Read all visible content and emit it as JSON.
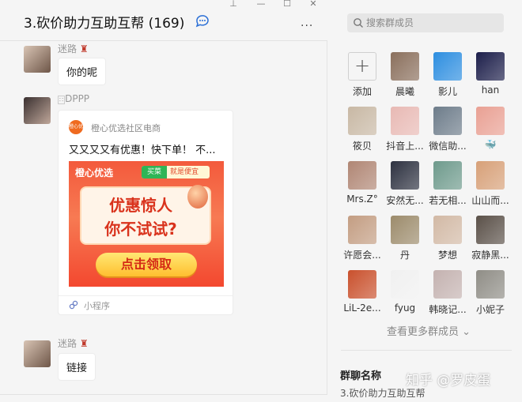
{
  "header": {
    "title": "3.砍价助力互助互帮 (169)",
    "more_label": "···"
  },
  "window_controls": {
    "pin": "⊥",
    "minimize": "—",
    "maximize": "☐",
    "close": "✕"
  },
  "messages": [
    {
      "sender": "迷路",
      "text": "你的呢"
    },
    {
      "sender": "DPPP",
      "card": {
        "source": "橙心优选社区电商",
        "logo_text": "橙心优选",
        "description": "又又又又有优惠！快下单！ 不...",
        "banner": {
          "brand": "橙心优选",
          "tag_a": "买菜",
          "tag_b": "就是便宜",
          "line1": "优惠惊人",
          "line2": "你不试试?",
          "button": "点击领取"
        },
        "type_label": "小程序"
      }
    },
    {
      "sender": "迷路",
      "text": "链接"
    }
  ],
  "members_panel": {
    "search_placeholder": "搜索群成员",
    "members": [
      {
        "name": "添加",
        "type": "add",
        "color": "#f5f5f5"
      },
      {
        "name": "晨曦",
        "color": "#8a6f5c"
      },
      {
        "name": "影儿",
        "color": "#2d8ee0"
      },
      {
        "name": "han",
        "color": "#1c1e4a"
      },
      {
        "name": "筱贝",
        "color": "#c8b8a4"
      },
      {
        "name": "抖音上...",
        "color": "#e8b9b4"
      },
      {
        "name": "微信助...",
        "color": "#6d7c8a"
      },
      {
        "name": "🐳",
        "color": "#e9a093"
      },
      {
        "name": "Mrs.Z°",
        "color": "#b08674"
      },
      {
        "name": "安然无...",
        "color": "#2d3140"
      },
      {
        "name": "若无相...",
        "color": "#6e9a8c"
      },
      {
        "name": "山山而...",
        "color": "#d7a078"
      },
      {
        "name": "许愿会...",
        "color": "#c39d82"
      },
      {
        "name": "丹",
        "color": "#9c8b6b"
      },
      {
        "name": "梦想",
        "color": "#d2b9a5"
      },
      {
        "name": "寂静黑...",
        "color": "#5a5048"
      },
      {
        "name": "LiL-2e...",
        "color": "#c9502c"
      },
      {
        "name": "fyug",
        "color": "#f0f0f0"
      },
      {
        "name": "韩晓记...",
        "color": "#c4b2b0"
      },
      {
        "name": "小妮子",
        "color": "#8f8d86"
      }
    ],
    "view_more": "查看更多群成员 ⌄",
    "group_name_label": "群聊名称",
    "group_name_value": "3.砍价助力互助互帮"
  },
  "watermark": "知乎 @罗皮蛋",
  "colors": {
    "background": "#f5f5f5",
    "bubble": "#ffffff",
    "banner_red": "#f35a3c",
    "button_yellow": "#ffbf2f"
  }
}
